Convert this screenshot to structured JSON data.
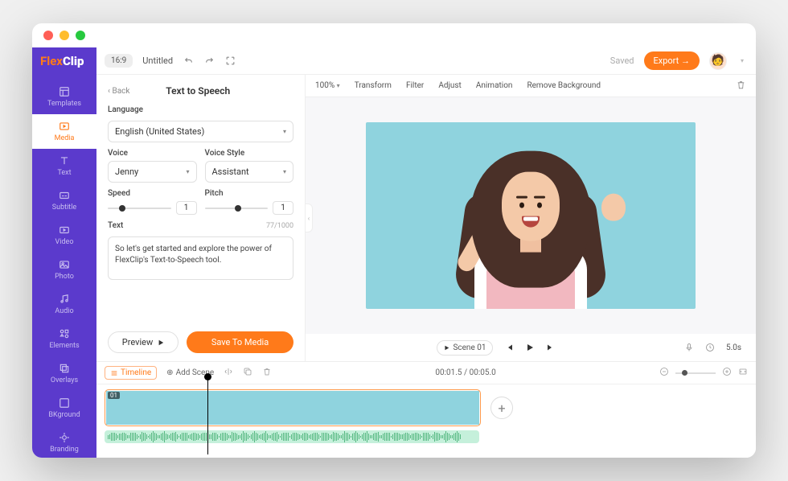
{
  "brand": {
    "flex": "Flex",
    "clip": "Clip"
  },
  "topbar": {
    "ratio": "16:9",
    "title": "Untitled",
    "saved": "Saved",
    "export": "Export →"
  },
  "sidebar": {
    "items": [
      {
        "label": "Templates"
      },
      {
        "label": "Media"
      },
      {
        "label": "Text"
      },
      {
        "label": "Subtitle"
      },
      {
        "label": "Video"
      },
      {
        "label": "Photo"
      },
      {
        "label": "Audio"
      },
      {
        "label": "Elements"
      },
      {
        "label": "Overlays"
      },
      {
        "label": "BKground"
      },
      {
        "label": "Branding"
      }
    ]
  },
  "panel": {
    "back": "Back",
    "title": "Text to Speech",
    "language": {
      "label": "Language",
      "value": "English (United States)"
    },
    "voice": {
      "label": "Voice",
      "value": "Jenny"
    },
    "style": {
      "label": "Voice Style",
      "value": "Assistant"
    },
    "speed": {
      "label": "Speed",
      "value": "1"
    },
    "pitch": {
      "label": "Pitch",
      "value": "1"
    },
    "text": {
      "label": "Text",
      "counter": "77/1000",
      "value": "So let's get started and explore the power of FlexClip's Text-to-Speech tool."
    },
    "preview": "Preview",
    "save": "Save To Media"
  },
  "ctoolbar": {
    "zoom": "100%",
    "transform": "Transform",
    "filter": "Filter",
    "adjust": "Adjust",
    "animation": "Animation",
    "removebg": "Remove Background"
  },
  "player": {
    "scene": "Scene 01",
    "duration": "5.0s"
  },
  "timeline": {
    "tl": "Timeline",
    "add": "Add Scene",
    "time": "00:01.5 / 00:05.0",
    "clip": "01"
  }
}
